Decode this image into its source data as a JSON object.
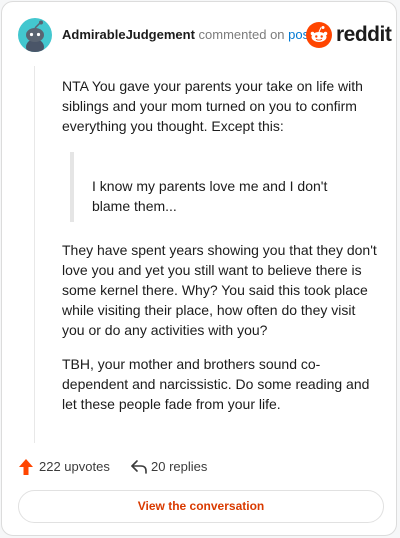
{
  "header": {
    "author": "AdmirableJudgement",
    "verb": "commented on",
    "post_link": "post",
    "brand": "reddit"
  },
  "comment": {
    "paragraph1": "NTA You gave your parents your take on life with siblings and your mom turned on you to confirm everything you thought. Except this:",
    "quote": "I know my parents love me and I don't blame them...",
    "paragraph2": "They have spent years showing you that they don't love you and yet you still want to believe there is some kernel there. Why? You said this took place while visiting their place, how often do they visit you or do any activities with you?",
    "paragraph3": "TBH, your mother and brothers sound co-dependent and narcissistic. Do some reading and let these people fade from your life."
  },
  "actions": {
    "upvotes": "222 upvotes",
    "replies": "20 replies",
    "upvote_icon": "upvote-arrow-icon",
    "reply_icon": "reply-arrow-icon"
  },
  "cta": {
    "label": "View the conversation"
  },
  "colors": {
    "accent": "#ff4500",
    "link": "#0079d3",
    "cta_text": "#d93a00",
    "avatar_bg": "#43c7cf"
  }
}
